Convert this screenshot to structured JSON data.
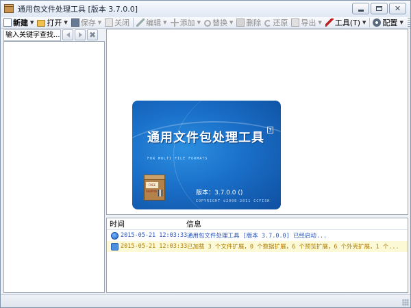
{
  "window": {
    "title": "通用包文件处理工具 [版本 3.7.0.0]"
  },
  "toolbar": {
    "new": "新建",
    "open": "打开",
    "save": "保存",
    "close": "关闭",
    "edit": "编辑",
    "add": "添加",
    "replace": "替换",
    "delete": "删除",
    "restore": "还原",
    "export": "导出",
    "tools": "工具(T)",
    "config": "配置"
  },
  "search": {
    "placeholder": "输入关键字查找..."
  },
  "splash": {
    "title": "通用文件包处理工具",
    "badge": "3",
    "subtitle": "FOR MULTI FILE FORMATS",
    "version": "版本：3.7.0.0 ()",
    "copyright": "COPYRIGHT ©2008-2011 CCFISH",
    "box_label": "FREE SHIPPING"
  },
  "log": {
    "col_time": "时间",
    "col_message": "信息",
    "rows": [
      {
        "time": "2015-05-21 12:03:33",
        "message": "通用包文件处理工具 [版本 3.7.0.0] 已经启动..."
      },
      {
        "time": "2015-05-21 12:03:33",
        "message": "已加载 3 个文件扩展，0 个数据扩展，6 个预览扩展，6 个外壳扩展，1 个..."
      }
    ]
  },
  "colors": {
    "accent": "#1a6fc8",
    "log_info": "#2a55b8",
    "log_warn": "#b07a00"
  }
}
